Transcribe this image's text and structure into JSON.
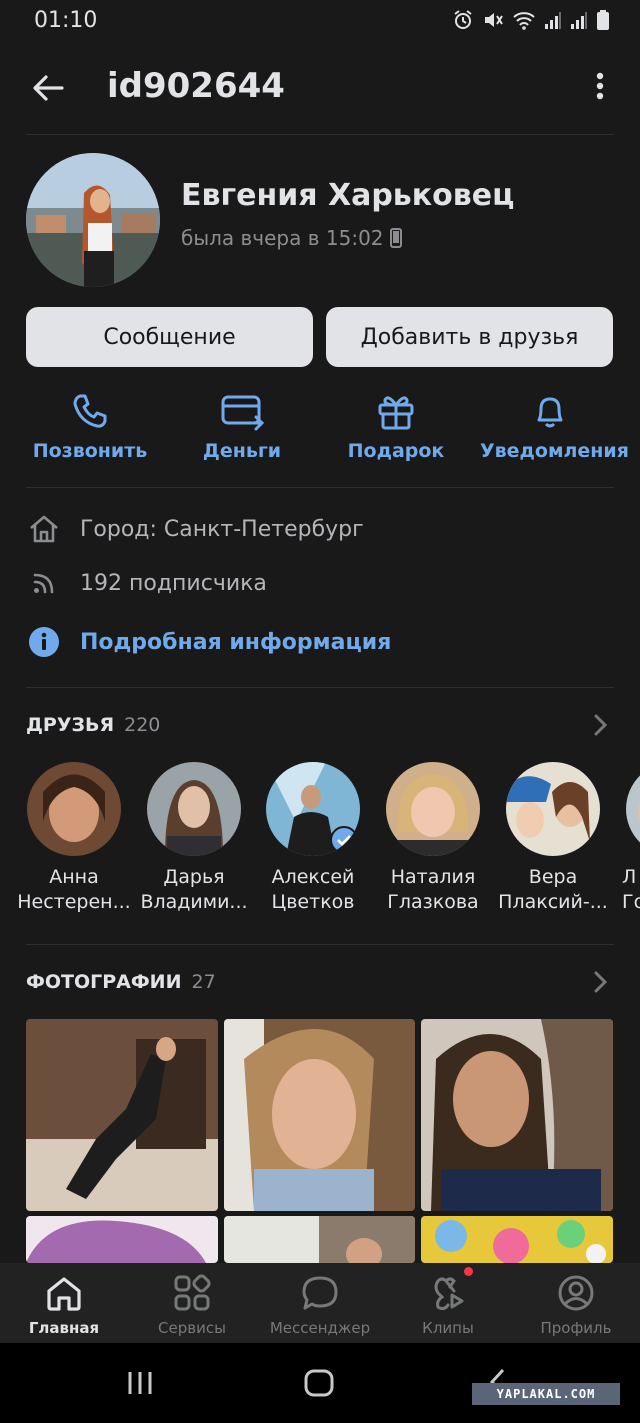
{
  "status_bar": {
    "time": "01:10",
    "icons": [
      "alarm-icon",
      "mute-icon",
      "wifi-icon",
      "signal-icon",
      "signal-icon",
      "battery-icon"
    ]
  },
  "header": {
    "title": "id902644"
  },
  "profile": {
    "name": "Евгения Харьковец",
    "last_seen": "была вчера в 15:02"
  },
  "buttons": {
    "message": "Сообщение",
    "add_friend": "Добавить в друзья"
  },
  "actions": [
    {
      "label": "Позвонить",
      "icon": "phone-icon"
    },
    {
      "label": "Деньги",
      "icon": "money-icon"
    },
    {
      "label": "Подарок",
      "icon": "gift-icon"
    },
    {
      "label": "Уведомления",
      "icon": "bell-icon"
    }
  ],
  "info": {
    "city": "Город: Санкт-Петербург",
    "followers": "192 подписчика",
    "details_link": "Подробная информация"
  },
  "friends": {
    "title": "ДРУЗЬЯ",
    "count": "220",
    "items": [
      {
        "line1": "Анна",
        "line2": "Нестерен..."
      },
      {
        "line1": "Дарья",
        "line2": "Владими..."
      },
      {
        "line1": "Алексей",
        "line2": "Цветков"
      },
      {
        "line1": "Наталия",
        "line2": "Глазкова"
      },
      {
        "line1": "Вера",
        "line2": "Плаксий-..."
      },
      {
        "line1": "Л",
        "line2": "Го"
      }
    ]
  },
  "photos": {
    "title": "ФОТОГРАФИИ",
    "count": "27"
  },
  "tabbar": {
    "items": [
      {
        "label": "Главная",
        "icon": "home-icon",
        "active": true
      },
      {
        "label": "Сервисы",
        "icon": "services-icon",
        "active": false
      },
      {
        "label": "Мессенджер",
        "icon": "messenger-icon",
        "active": false
      },
      {
        "label": "Клипы",
        "icon": "clips-icon",
        "active": false
      },
      {
        "label": "Профиль",
        "icon": "profile-icon",
        "active": false
      }
    ]
  },
  "watermark": "YAPLAKAL.COM",
  "colors": {
    "background": "#19191a",
    "accent": "#71aaeb",
    "button_bg": "#e1e3e6",
    "tab_badge": "#ff3347"
  }
}
